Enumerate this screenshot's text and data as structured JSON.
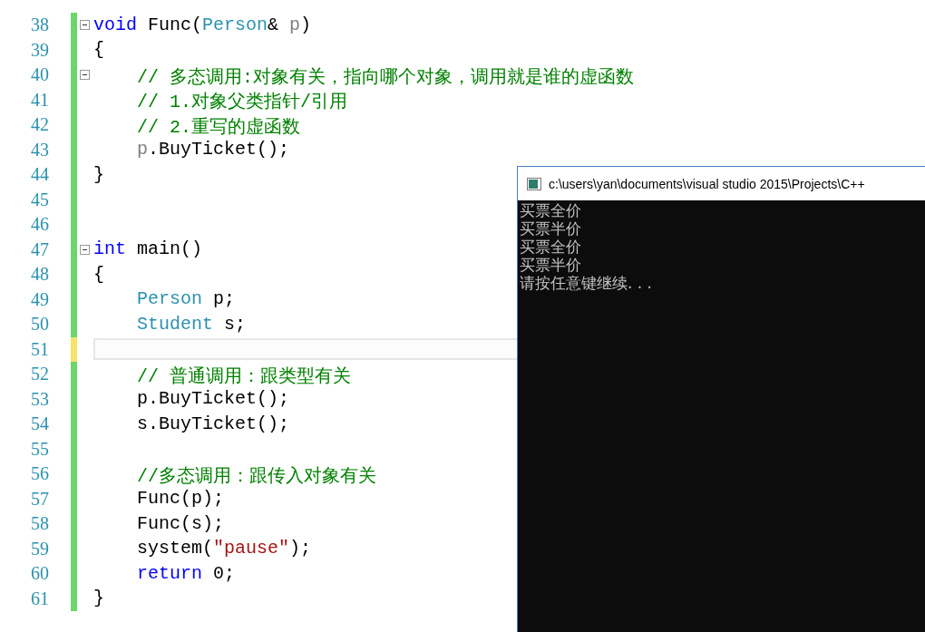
{
  "editor": {
    "lines": [
      {
        "number": "38",
        "unsaved": false,
        "fold": true,
        "current": false,
        "tokens": [
          {
            "kind": "keyword",
            "text": "void"
          },
          {
            "kind": "plain",
            "text": " Func("
          },
          {
            "kind": "type",
            "text": "Person"
          },
          {
            "kind": "plain",
            "text": "& "
          },
          {
            "kind": "param",
            "text": "p"
          },
          {
            "kind": "plain",
            "text": ")"
          }
        ]
      },
      {
        "number": "39",
        "unsaved": false,
        "fold": false,
        "current": false,
        "tokens": [
          {
            "kind": "plain",
            "text": "{"
          }
        ]
      },
      {
        "number": "40",
        "unsaved": false,
        "fold": true,
        "current": false,
        "tokens": [
          {
            "kind": "comment",
            "text": "    // 多态调用:对象有关，指向哪个对象，调用就是谁的虚函数"
          }
        ]
      },
      {
        "number": "41",
        "unsaved": false,
        "fold": false,
        "current": false,
        "tokens": [
          {
            "kind": "comment",
            "text": "    // 1.对象父类指针/引用"
          }
        ]
      },
      {
        "number": "42",
        "unsaved": false,
        "fold": false,
        "current": false,
        "tokens": [
          {
            "kind": "comment",
            "text": "    // 2.重写的虚函数"
          }
        ]
      },
      {
        "number": "43",
        "unsaved": false,
        "fold": false,
        "current": false,
        "tokens": [
          {
            "kind": "param",
            "text": "    p"
          },
          {
            "kind": "plain",
            "text": ".BuyTicket();"
          }
        ]
      },
      {
        "number": "44",
        "unsaved": false,
        "fold": false,
        "current": false,
        "tokens": [
          {
            "kind": "plain",
            "text": "}"
          }
        ]
      },
      {
        "number": "45",
        "unsaved": false,
        "fold": false,
        "current": false
      },
      {
        "number": "46",
        "unsaved": false,
        "fold": false,
        "current": false
      },
      {
        "number": "47",
        "unsaved": false,
        "fold": true,
        "current": false,
        "tokens": [
          {
            "kind": "keyword",
            "text": "int"
          },
          {
            "kind": "plain",
            "text": " main()"
          }
        ]
      },
      {
        "number": "48",
        "unsaved": false,
        "fold": false,
        "current": false,
        "tokens": [
          {
            "kind": "plain",
            "text": "{"
          }
        ]
      },
      {
        "number": "49",
        "unsaved": false,
        "fold": false,
        "current": false,
        "tokens": [
          {
            "kind": "type",
            "text": "    Person"
          },
          {
            "kind": "plain",
            "text": " p;"
          }
        ]
      },
      {
        "number": "50",
        "unsaved": false,
        "fold": false,
        "current": false,
        "tokens": [
          {
            "kind": "type",
            "text": "    Student"
          },
          {
            "kind": "plain",
            "text": " s;"
          }
        ]
      },
      {
        "number": "51",
        "unsaved": true,
        "fold": false,
        "current": true
      },
      {
        "number": "52",
        "unsaved": false,
        "fold": false,
        "current": false,
        "tokens": [
          {
            "kind": "comment",
            "text": "    // 普通调用：跟类型有关"
          }
        ]
      },
      {
        "number": "53",
        "unsaved": false,
        "fold": false,
        "current": false,
        "tokens": [
          {
            "kind": "plain",
            "text": "    p.BuyTicket();"
          }
        ]
      },
      {
        "number": "54",
        "unsaved": false,
        "fold": false,
        "current": false,
        "tokens": [
          {
            "kind": "plain",
            "text": "    s.BuyTicket();"
          }
        ]
      },
      {
        "number": "55",
        "unsaved": false,
        "fold": false,
        "current": false
      },
      {
        "number": "56",
        "unsaved": false,
        "fold": false,
        "current": false,
        "tokens": [
          {
            "kind": "comment",
            "text": "    //多态调用：跟传入对象有关"
          }
        ]
      },
      {
        "number": "57",
        "unsaved": false,
        "fold": false,
        "current": false,
        "tokens": [
          {
            "kind": "plain",
            "text": "    Func(p);"
          }
        ]
      },
      {
        "number": "58",
        "unsaved": false,
        "fold": false,
        "current": false,
        "tokens": [
          {
            "kind": "plain",
            "text": "    Func(s);"
          }
        ]
      },
      {
        "number": "59",
        "unsaved": false,
        "fold": false,
        "current": false,
        "tokens": [
          {
            "kind": "plain",
            "text": "    system("
          },
          {
            "kind": "string",
            "text": "\"pause\""
          },
          {
            "kind": "plain",
            "text": ");"
          }
        ]
      },
      {
        "number": "60",
        "unsaved": false,
        "fold": false,
        "current": false,
        "tokens": [
          {
            "kind": "keyword",
            "text": "    return"
          },
          {
            "kind": "plain",
            "text": " 0;"
          }
        ]
      },
      {
        "number": "61",
        "unsaved": false,
        "fold": false,
        "current": false,
        "tokens": [
          {
            "kind": "plain",
            "text": "}"
          }
        ]
      }
    ]
  },
  "console": {
    "title": "c:\\users\\yan\\documents\\visual studio 2015\\Projects\\C++",
    "lines": [
      "买票全价",
      "买票半价",
      "买票全价",
      "买票半价",
      "请按任意键继续. . ."
    ]
  }
}
